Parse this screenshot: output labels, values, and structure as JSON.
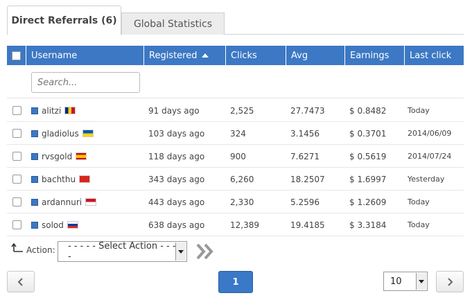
{
  "tabs": [
    {
      "label": "Direct Referrals (6)",
      "active": true
    },
    {
      "label": "Global Statistics",
      "active": false
    }
  ],
  "columns": [
    "Username",
    "Registered",
    "Clicks",
    "Avg",
    "Earnings",
    "Last click"
  ],
  "search": {
    "placeholder": "Search..."
  },
  "rows": [
    {
      "username": "alitzi",
      "flag": "romania",
      "registered": "91 days ago",
      "clicks": "2,525",
      "avg": "27.7473",
      "earnings": "$ 0.8482",
      "last_click": "Today"
    },
    {
      "username": "gladiolus",
      "flag": "ukraine",
      "registered": "103 days ago",
      "clicks": "324",
      "avg": "3.1456",
      "earnings": "$ 0.3701",
      "last_click": "2014/06/09"
    },
    {
      "username": "rvsgold",
      "flag": "spain",
      "registered": "118 days ago",
      "clicks": "900",
      "avg": "7.6271",
      "earnings": "$ 0.5619",
      "last_click": "2014/07/24"
    },
    {
      "username": "bachthu",
      "flag": "vietnam",
      "registered": "343 days ago",
      "clicks": "6,260",
      "avg": "18.2507",
      "earnings": "$ 1.6997",
      "last_click": "Yesterday"
    },
    {
      "username": "ardannuri",
      "flag": "indonesia",
      "registered": "443 days ago",
      "clicks": "2,330",
      "avg": "5.2596",
      "earnings": "$ 1.2609",
      "last_click": "Today"
    },
    {
      "username": "solod",
      "flag": "russia",
      "registered": "638 days ago",
      "clicks": "12,389",
      "avg": "19.4185",
      "earnings": "$ 3.3184",
      "last_click": "Today"
    }
  ],
  "action": {
    "label": "Action:",
    "selected": "- - - - - Select Action - - - - -"
  },
  "pagination": {
    "current_page": "1",
    "per_page": "10"
  },
  "colors": {
    "header_blue": "#3c78c4",
    "page_blue": "#3a78c8"
  }
}
